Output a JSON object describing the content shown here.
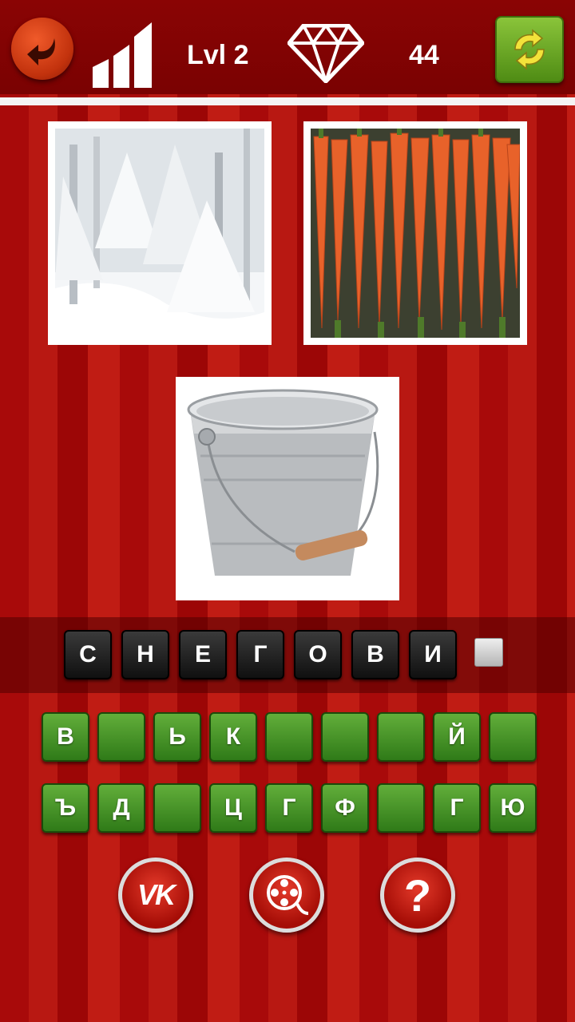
{
  "header": {
    "level_label": "Lvl 2",
    "coins": "44"
  },
  "images": [
    {
      "name": "snowy-forest"
    },
    {
      "name": "carrots"
    },
    {
      "name": "metal-bucket"
    }
  ],
  "answer_letters": [
    "С",
    "Н",
    "Е",
    "Г",
    "О",
    "В",
    "И"
  ],
  "keyboard": {
    "row1": [
      "В",
      "",
      "Ь",
      "К",
      "",
      "",
      "",
      "Й",
      ""
    ],
    "row2": [
      "Ъ",
      "Д",
      "",
      "Ц",
      "Г",
      "Ф",
      "",
      "Г",
      "Ю"
    ]
  },
  "buttons": {
    "vk_label": "VK",
    "help_label": "?"
  },
  "colors": {
    "background_red": "#a80a0a",
    "tile_green": "#4a961f",
    "tile_dark": "#1e1e1e",
    "button_red": "#c01a10"
  },
  "icons": [
    "back-arrow-icon",
    "stats-bars-icon",
    "diamond-icon",
    "refresh-icon",
    "vk-logo-icon",
    "film-reel-icon",
    "question-mark-icon"
  ]
}
